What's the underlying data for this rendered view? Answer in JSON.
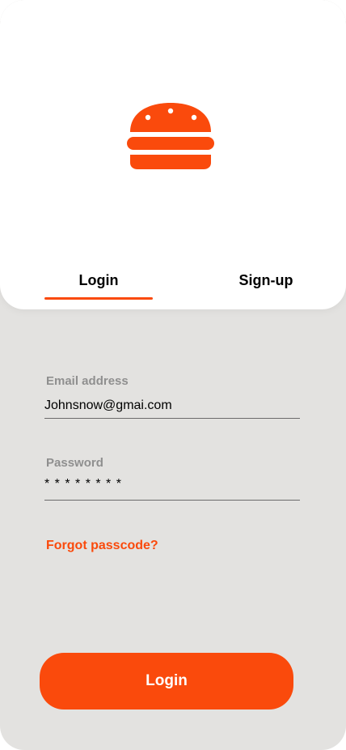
{
  "colors": {
    "accent": "#fa4a0c",
    "background": "#e3e2e0",
    "card": "#ffffff"
  },
  "logo": {
    "icon": "burger-icon"
  },
  "tabs": [
    {
      "label": "Login",
      "active": true
    },
    {
      "label": "Sign-up",
      "active": false
    }
  ],
  "form": {
    "email": {
      "label": "Email address",
      "value": "Johnsnow@gmai.com"
    },
    "password": {
      "label": "Password",
      "value": "* * * * * * * *"
    },
    "forgot_label": "Forgot passcode?",
    "submit_label": "Login"
  }
}
